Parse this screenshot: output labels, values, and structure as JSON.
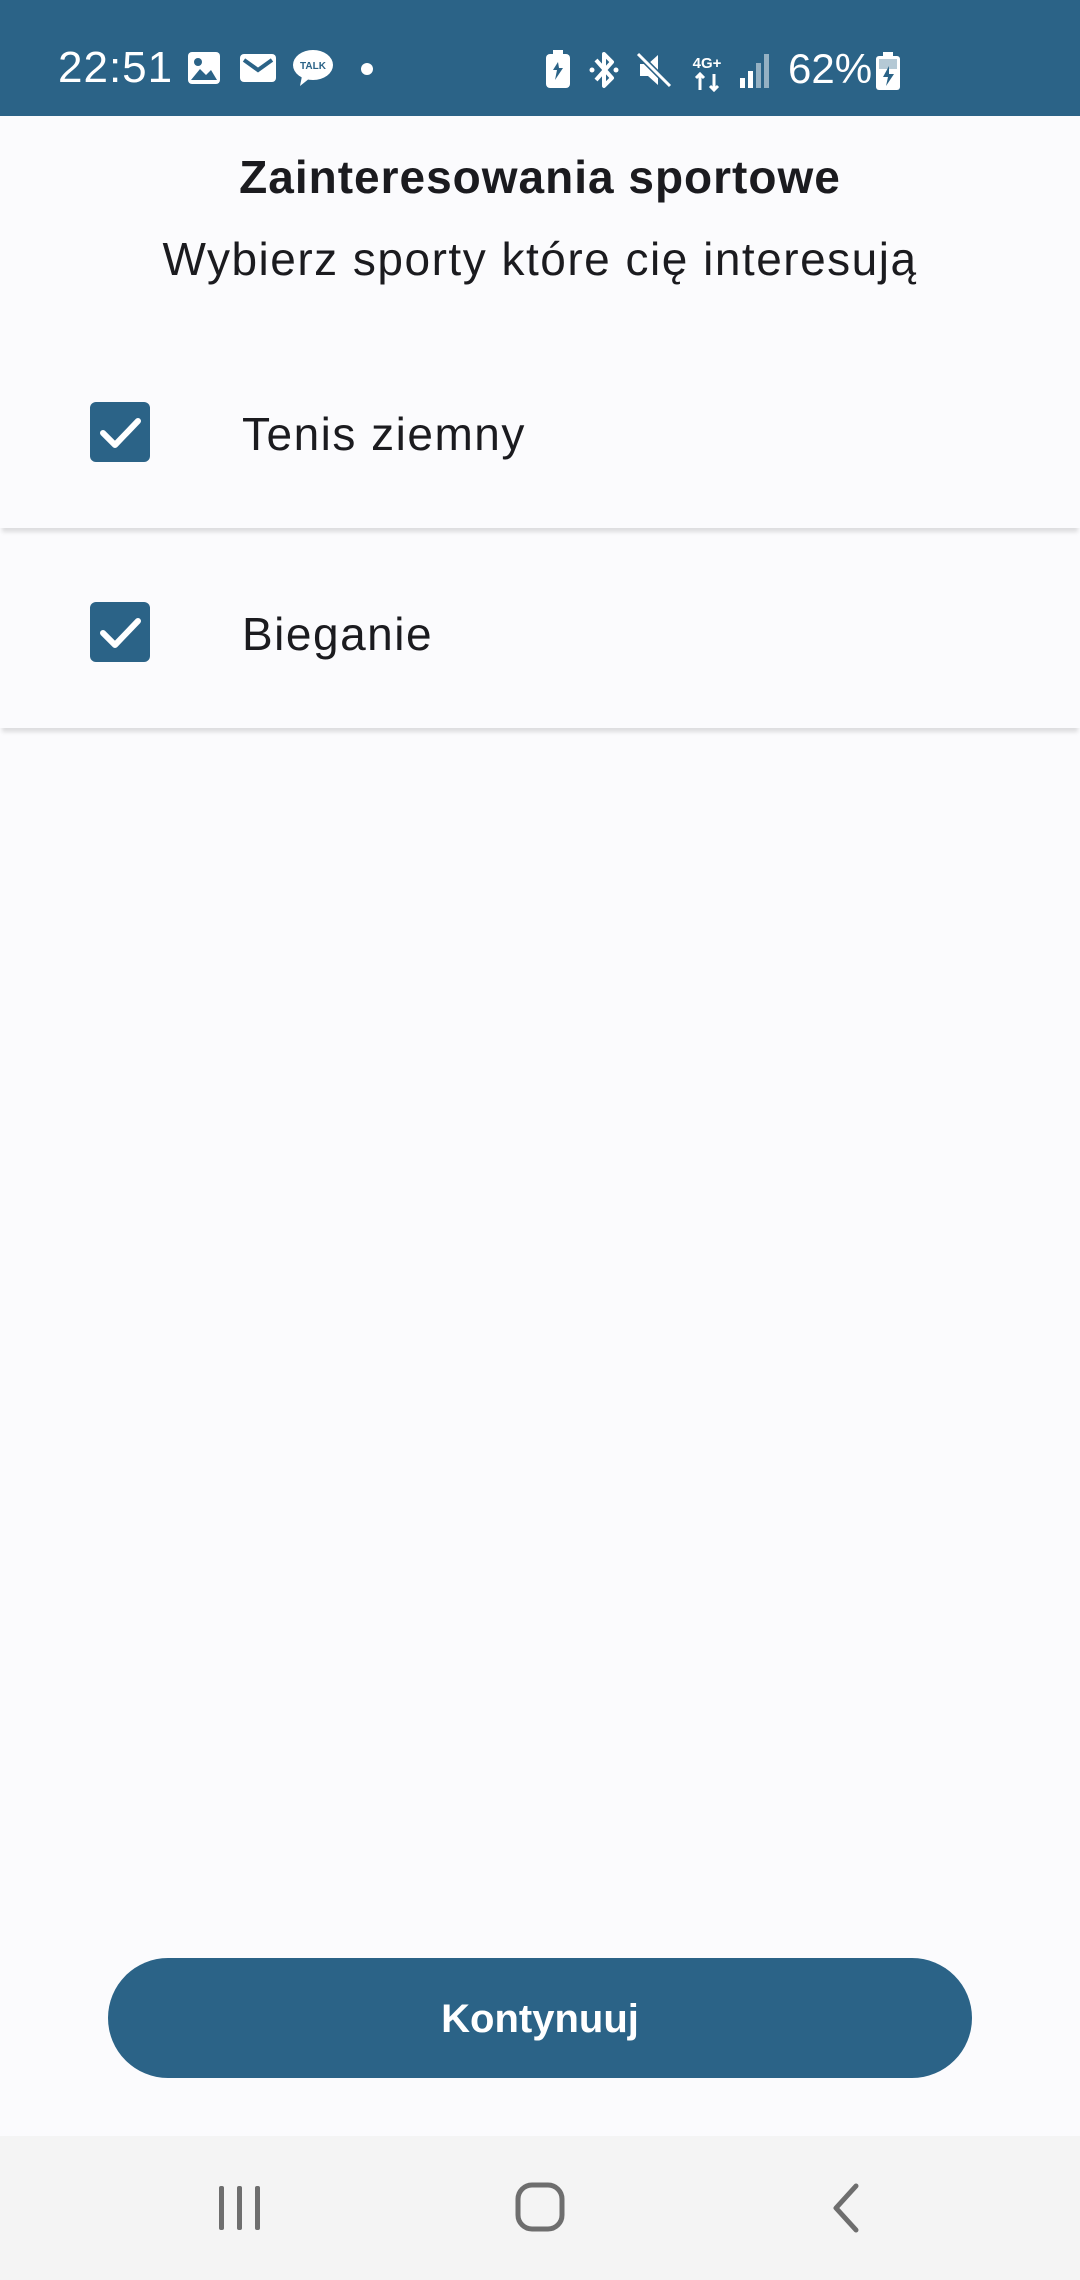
{
  "status_bar": {
    "time": "22:51",
    "battery_percent": "62%",
    "network_label": "4G+",
    "icons": [
      "gallery-icon",
      "mail-icon",
      "talk-icon",
      "notification-dot",
      "battery-saver-icon",
      "bluetooth-icon",
      "mute-icon",
      "network-4g-icon",
      "signal-icon",
      "battery-charging-icon"
    ],
    "background_color": "#2B6387"
  },
  "header": {
    "title": "Zainteresowania sportowe",
    "subtitle": "Wybierz sporty które cię interesują"
  },
  "sports": [
    {
      "label": "Tenis ziemny",
      "checked": true
    },
    {
      "label": "Bieganie",
      "checked": true
    }
  ],
  "continue_button": {
    "label": "Kontynuuj"
  },
  "nav_bar": {
    "icons": [
      "recent-apps-icon",
      "home-icon",
      "back-icon"
    ]
  },
  "colors": {
    "accent": "#2B6387",
    "background": "#FBFBFD",
    "text": "#1B1B1F"
  }
}
